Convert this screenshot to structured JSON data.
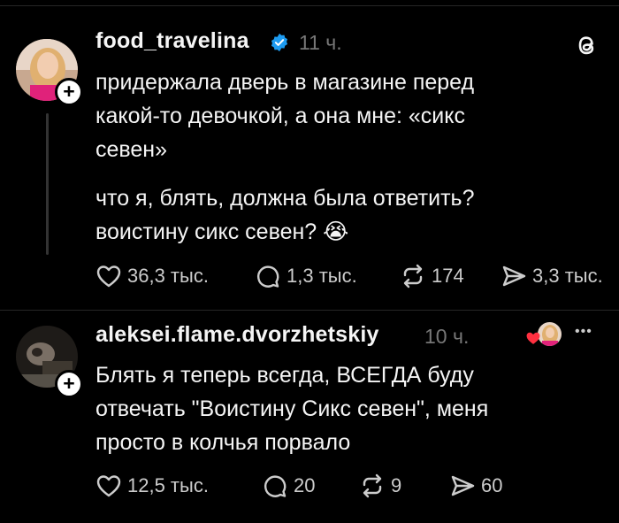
{
  "post1": {
    "username": "food_travelina",
    "time": "11 ч.",
    "text1": "придержала дверь в магазине перед какой-то девочкой, а она мне: «сикс севен»",
    "text2": "что я, блять, должна была ответить? воистину сикс севен? 😭",
    "likes": "36,3 тыс.",
    "comments": "1,3 тыс.",
    "reposts": "174",
    "shares": "3,3 тыс."
  },
  "post2": {
    "username": "aleksei.flame.dvorzhetskiy",
    "time": "10 ч.",
    "more": "•••",
    "text": "Блять я теперь всегда, ВСЕГДА буду отвечать \"Воистину Сикс севен\", меня просто в колчья порвало",
    "likes": "12,5 тыс.",
    "comments": "20",
    "reposts": "9",
    "shares": "60"
  },
  "icons": {
    "threads_logo": "threads-logo-icon",
    "verified": "verified-badge-icon",
    "like": "heart-icon",
    "comment": "comment-icon",
    "repost": "repost-icon",
    "share": "share-icon"
  },
  "colors": {
    "verified": "#1d9bf0",
    "like_heart": "#ff3040"
  }
}
